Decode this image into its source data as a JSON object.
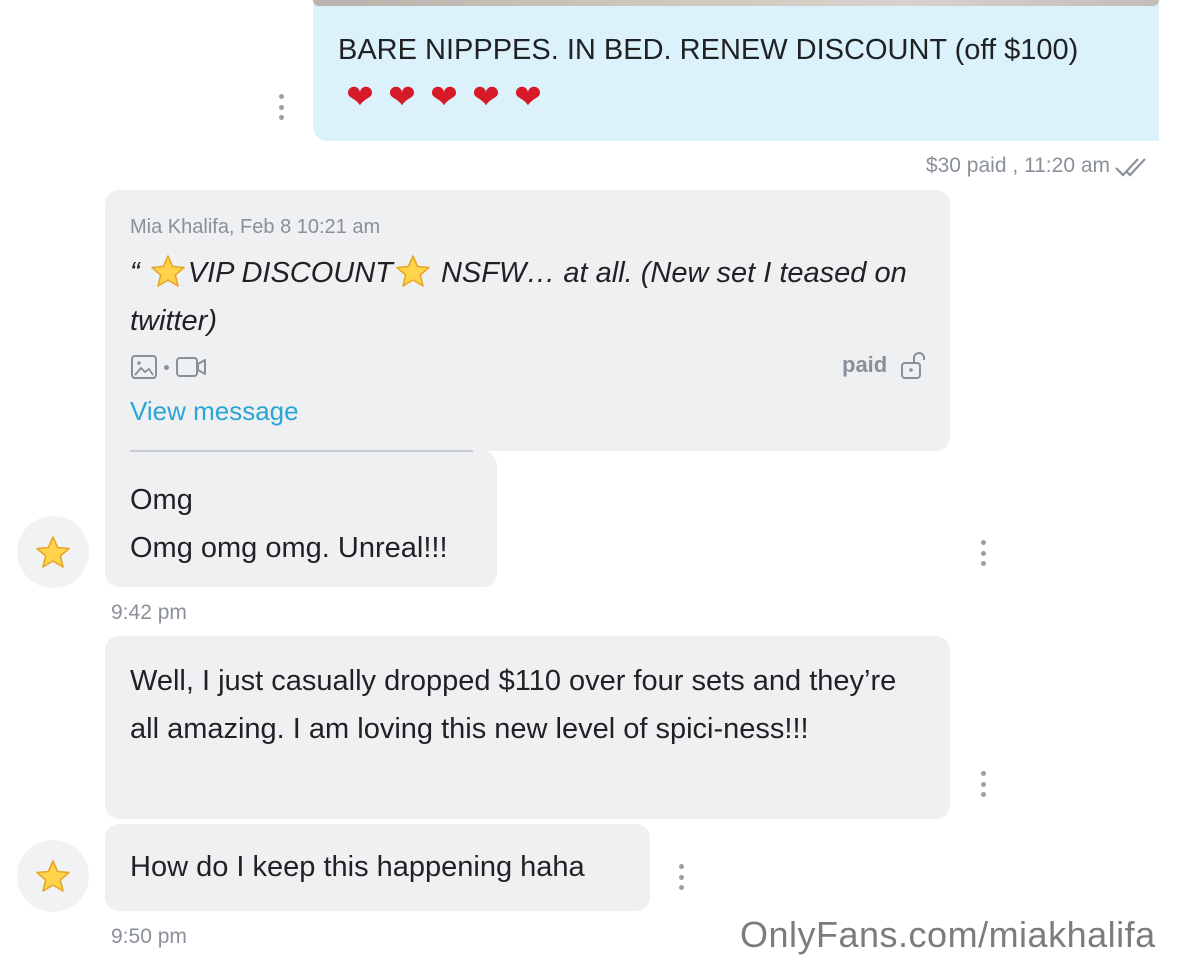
{
  "sent_message": {
    "text": "BARE NIPPPES. IN BED. RENEW DISCOUNT (off $100)",
    "hearts": [
      "❤",
      "❤",
      "❤",
      "❤",
      "❤"
    ],
    "meta": "$30 paid , 11:20 am"
  },
  "quoted_message": {
    "header": "Mia Khalifa, Feb 8 10:21 am",
    "open_quote": "“",
    "text_part1": "VIP DISCOUNT",
    "text_part2": " NSFW… at all. (New set I teased on twitter)",
    "paid_label": "paid",
    "view_link": "View message"
  },
  "reply_message": {
    "line1": "Omg",
    "line2": "Omg omg omg. Unreal!!!",
    "time": "9:42 pm"
  },
  "message_two": {
    "text": "Well, I just casually dropped $110 over four sets and they’re all amazing. I am loving this new level of spici-ness!!!"
  },
  "message_three": {
    "text": "How do I keep this happening haha",
    "time": "9:50 pm"
  },
  "watermark": "OnlyFans.com/miakhalifa",
  "colors": {
    "sent_bubble": "#dbf2fb",
    "received_bubble": "#eff0f2",
    "link": "#2aa6d6",
    "meta_text": "#8a9099",
    "heart": "#d71a28"
  }
}
